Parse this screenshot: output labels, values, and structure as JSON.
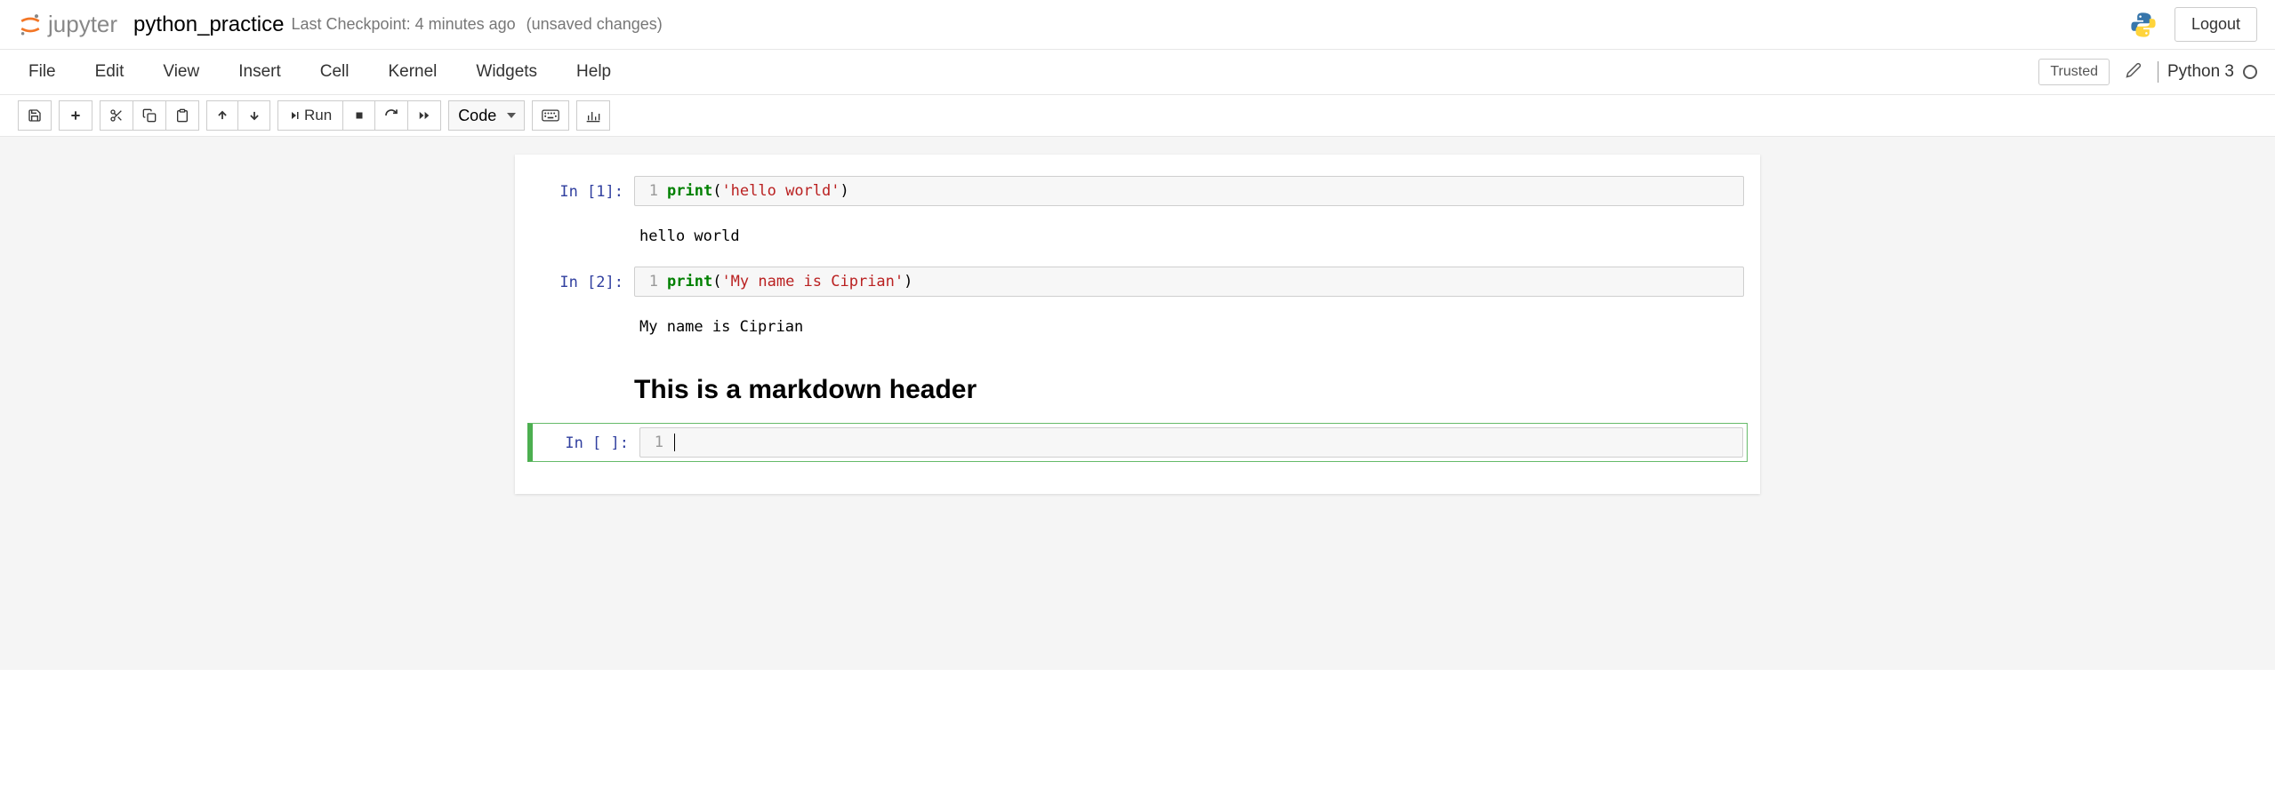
{
  "header": {
    "logo_text": "jupyter",
    "notebook_name": "python_practice",
    "checkpoint": "Last Checkpoint: 4 minutes ago",
    "unsaved": "(unsaved changes)",
    "logout": "Logout"
  },
  "menu": {
    "items": [
      "File",
      "Edit",
      "View",
      "Insert",
      "Cell",
      "Kernel",
      "Widgets",
      "Help"
    ],
    "trusted": "Trusted",
    "kernel": "Python 3"
  },
  "toolbar": {
    "run_label": "Run",
    "cell_type": "Code"
  },
  "cells": [
    {
      "type": "code",
      "exec_count": "1",
      "prompt": "In [1]:",
      "line_num": "1",
      "code_fn": "print",
      "code_str": "'hello world'",
      "output": "hello world"
    },
    {
      "type": "code",
      "exec_count": "2",
      "prompt": "In [2]:",
      "line_num": "1",
      "code_fn": "print",
      "code_str": "'My name is Ciprian'",
      "output": "My name is Ciprian"
    },
    {
      "type": "markdown",
      "rendered": "This is a markdown header"
    },
    {
      "type": "code",
      "exec_count": "",
      "prompt": "In [ ]:",
      "line_num": "1",
      "code": "",
      "selected": true
    }
  ]
}
